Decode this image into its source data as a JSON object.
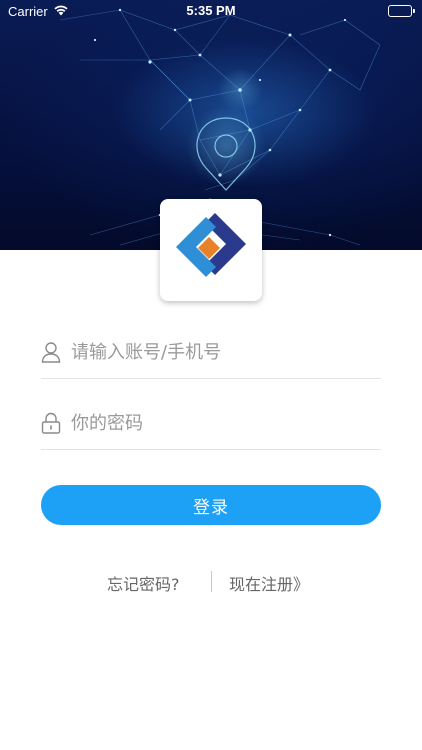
{
  "status_bar": {
    "carrier": "Carrier",
    "time": "5:35 PM",
    "battery_level": 1.0
  },
  "icons": {
    "wifi": "wifi-icon",
    "battery": "battery-icon",
    "account": "user-icon",
    "password": "lock-icon",
    "logo": "app-logo"
  },
  "form": {
    "account_placeholder": "请输入账号/手机号",
    "account_value": "",
    "password_placeholder": "你的密码",
    "password_value": "",
    "login_label": "登录"
  },
  "links": {
    "forgot_password": "忘记密码?",
    "register": "现在注册》"
  },
  "colors": {
    "accent": "#1da1f7",
    "hero_dark": "#061140",
    "logo_dark_blue": "#2b3a8c",
    "logo_light_blue": "#2f8fd6",
    "logo_orange": "#e8822a"
  }
}
